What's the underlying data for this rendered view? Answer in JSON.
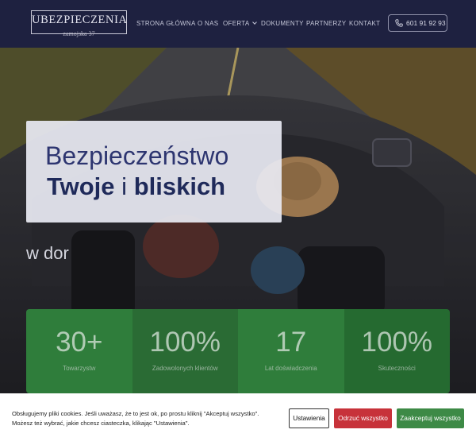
{
  "brand": {
    "title": "UBEZPIECZENIA",
    "subtitle": "zamojska 37"
  },
  "nav": {
    "items": [
      {
        "label": "STRONA GŁÓWNA"
      },
      {
        "label": "O NAS"
      },
      {
        "label": "OFERTA"
      },
      {
        "label": "DOKUMENTY"
      },
      {
        "label": "PARTNERZY"
      },
      {
        "label": "KONTAKT"
      }
    ],
    "phone": "601 91 92 93"
  },
  "hero": {
    "line1": "Bezpieczeństwo",
    "line2_a": "Twoje",
    "line2_b": "i",
    "line2_c": "bliskich",
    "sub": "w dor"
  },
  "stats": [
    {
      "value": "30+",
      "label": "Towarzystw",
      "color": "#2f7d3b"
    },
    {
      "value": "100%",
      "label": "Zadowolonych klientów",
      "color": "#2a6b34"
    },
    {
      "value": "17",
      "label": "Lat doświadczenia",
      "color": "#2f7d3b"
    },
    {
      "value": "100%",
      "label": "Skuteczności",
      "color": "#256a30"
    }
  ],
  "cookie": {
    "text_line1": "Obsługujemy pliki cookies. Jeśli uważasz, że to jest ok, po prostu kliknij \"Akceptuj wszystko\".",
    "text_line2": "Możesz też wybrać, jakie chcesz ciasteczka, klikając \"Ustawienia\".",
    "settings_label": "Ustawienia",
    "reject_label": "Odrzuć wszystko",
    "accept_label": "Zaakceptuj wszystko"
  },
  "colors": {
    "header_bg": "#1e2140",
    "stat_green": "#2f7d3b",
    "reject_red": "#c7323a",
    "accept_green": "#3d8a46"
  }
}
